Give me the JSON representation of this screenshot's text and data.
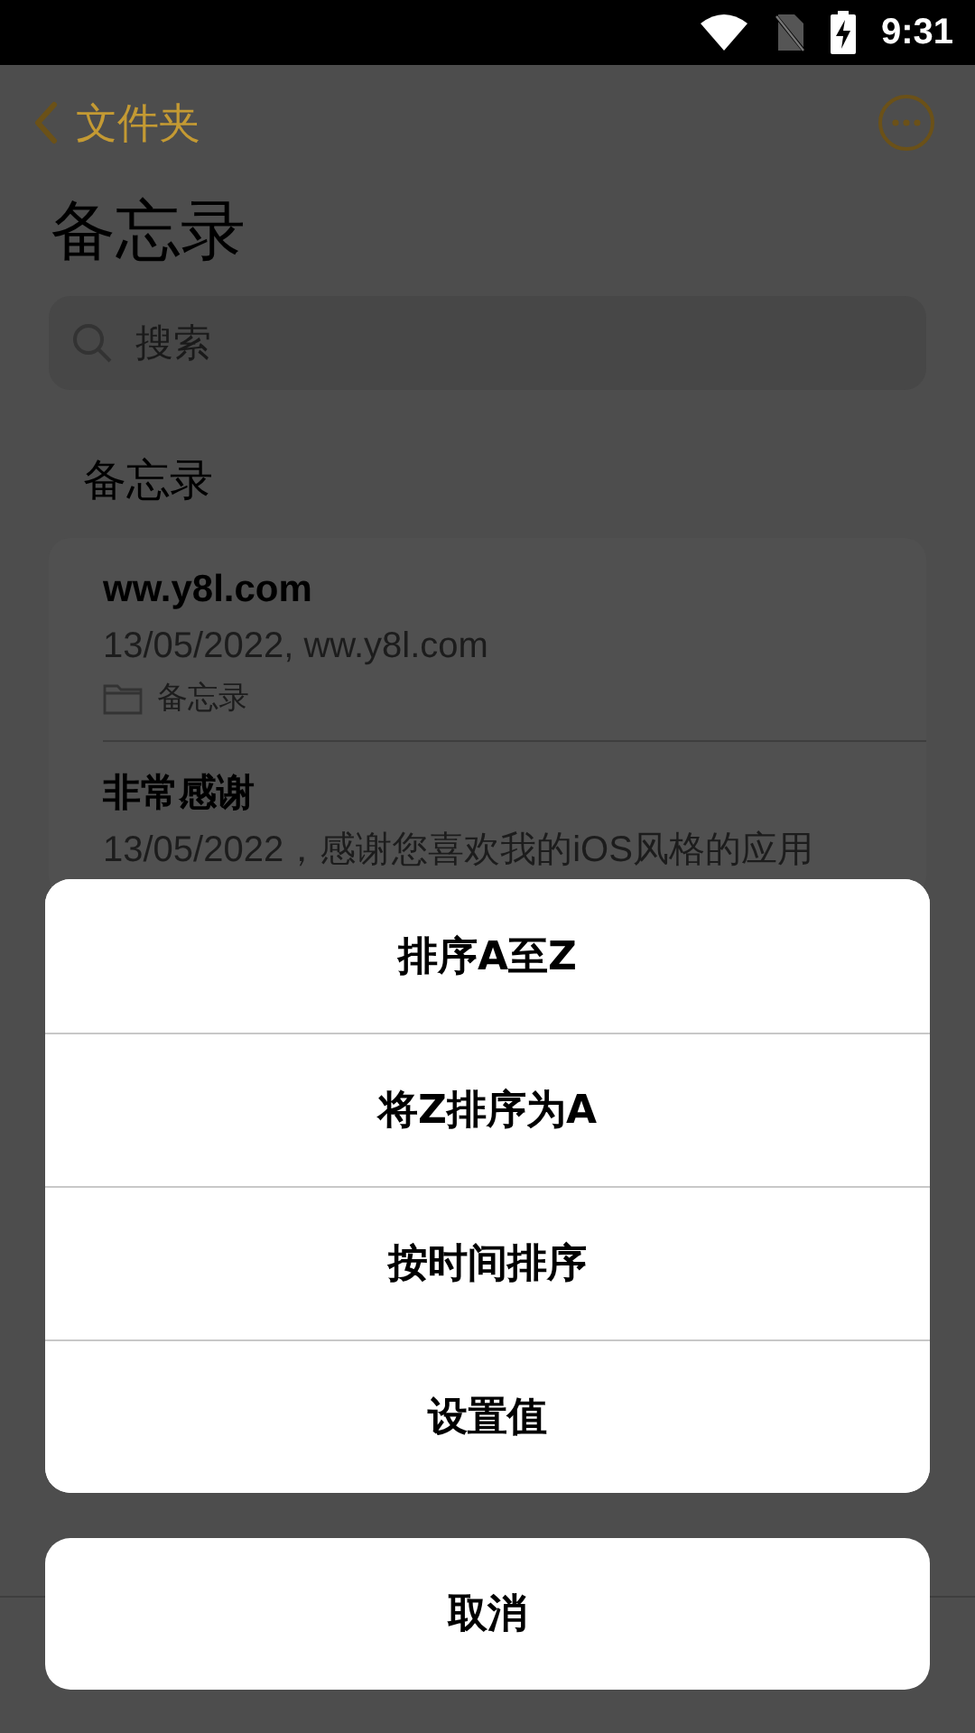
{
  "status_bar": {
    "time": "9:31"
  },
  "nav": {
    "back_label": "文件夹"
  },
  "title": "备忘录",
  "search": {
    "placeholder": "搜索"
  },
  "section_title": "备忘录",
  "notes": [
    {
      "title": "ww.y8l.com",
      "subtitle": "13/05/2022,  ww.y8l.com",
      "folder": "备忘录"
    },
    {
      "title": "非常感谢",
      "subtitle": "13/05/2022，感谢您喜欢我的iOS风格的应用"
    }
  ],
  "action_sheet": {
    "options": [
      "排序A至Z",
      "将Z排序为A",
      "按时间排序",
      "设置值"
    ],
    "cancel": "取消"
  }
}
